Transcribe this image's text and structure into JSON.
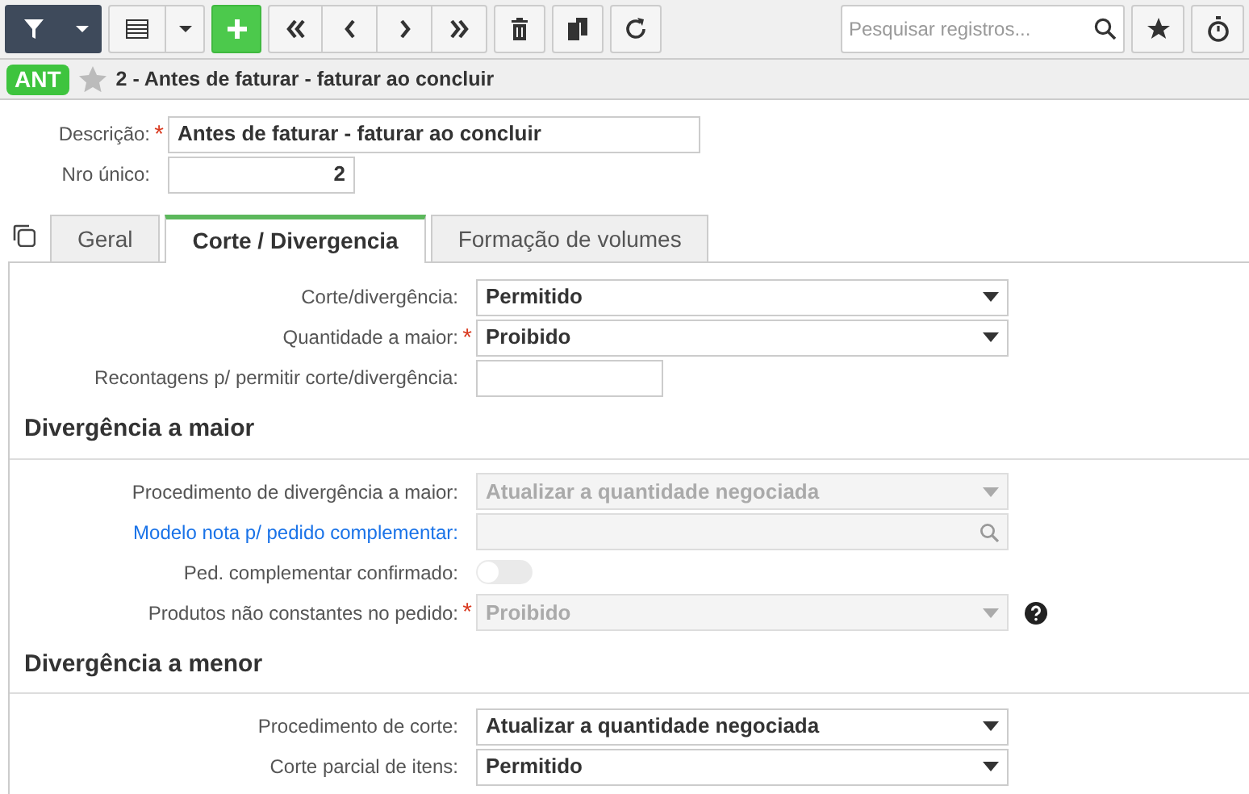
{
  "toolbar": {
    "search": {
      "placeholder": "Pesquisar registros..."
    }
  },
  "record": {
    "badge": "ANT",
    "title": "2 - Antes de faturar - faturar ao concluir",
    "favorite": false
  },
  "header_fields": [
    {
      "label": "Descrição:",
      "required_mark": "*",
      "kind": "text",
      "value": "Antes de faturar - faturar ao concluir"
    },
    {
      "label": "Nro único:",
      "kind": "number",
      "value": "2"
    }
  ],
  "tabs": [
    {
      "label": "Geral",
      "selected": false
    },
    {
      "label": "Corte / Divergencia",
      "selected": true
    },
    {
      "label": "Formação de volumes",
      "selected": false
    }
  ],
  "tab_fields": [
    {
      "label": "Corte/divergência:",
      "kind": "select",
      "value": "Permitido",
      "disabled": false
    },
    {
      "label": "Quantidade a maior:",
      "required_mark": "*",
      "kind": "select",
      "value": "Proibido",
      "disabled": false
    },
    {
      "label": "Recontagens p/ permitir corte/divergência:",
      "kind": "number",
      "disabled": false
    }
  ],
  "sections": [
    {
      "title": "Divergência a maior",
      "fields": [
        {
          "label": "Procedimento de divergência a maior:",
          "kind": "select",
          "value": "Atualizar a quantidade negociada",
          "disabled": true
        },
        {
          "label": "Modelo nota p/ pedido complementar:",
          "kind": "lookup",
          "link": true,
          "disabled": true
        },
        {
          "label": "Ped. complementar confirmado:",
          "kind": "switch",
          "on": false,
          "disabled": true
        },
        {
          "label": "Produtos não constantes no pedido:",
          "required_mark": "*",
          "kind": "select",
          "value": "Proibido",
          "disabled": true,
          "help": true
        }
      ]
    },
    {
      "title": "Divergência a menor",
      "fields": [
        {
          "label": "Procedimento de corte:",
          "kind": "select",
          "value": "Atualizar a quantidade negociada",
          "disabled": false
        },
        {
          "label": "Corte parcial de itens:",
          "kind": "select",
          "value": "Permitido",
          "disabled": false
        }
      ]
    }
  ]
}
